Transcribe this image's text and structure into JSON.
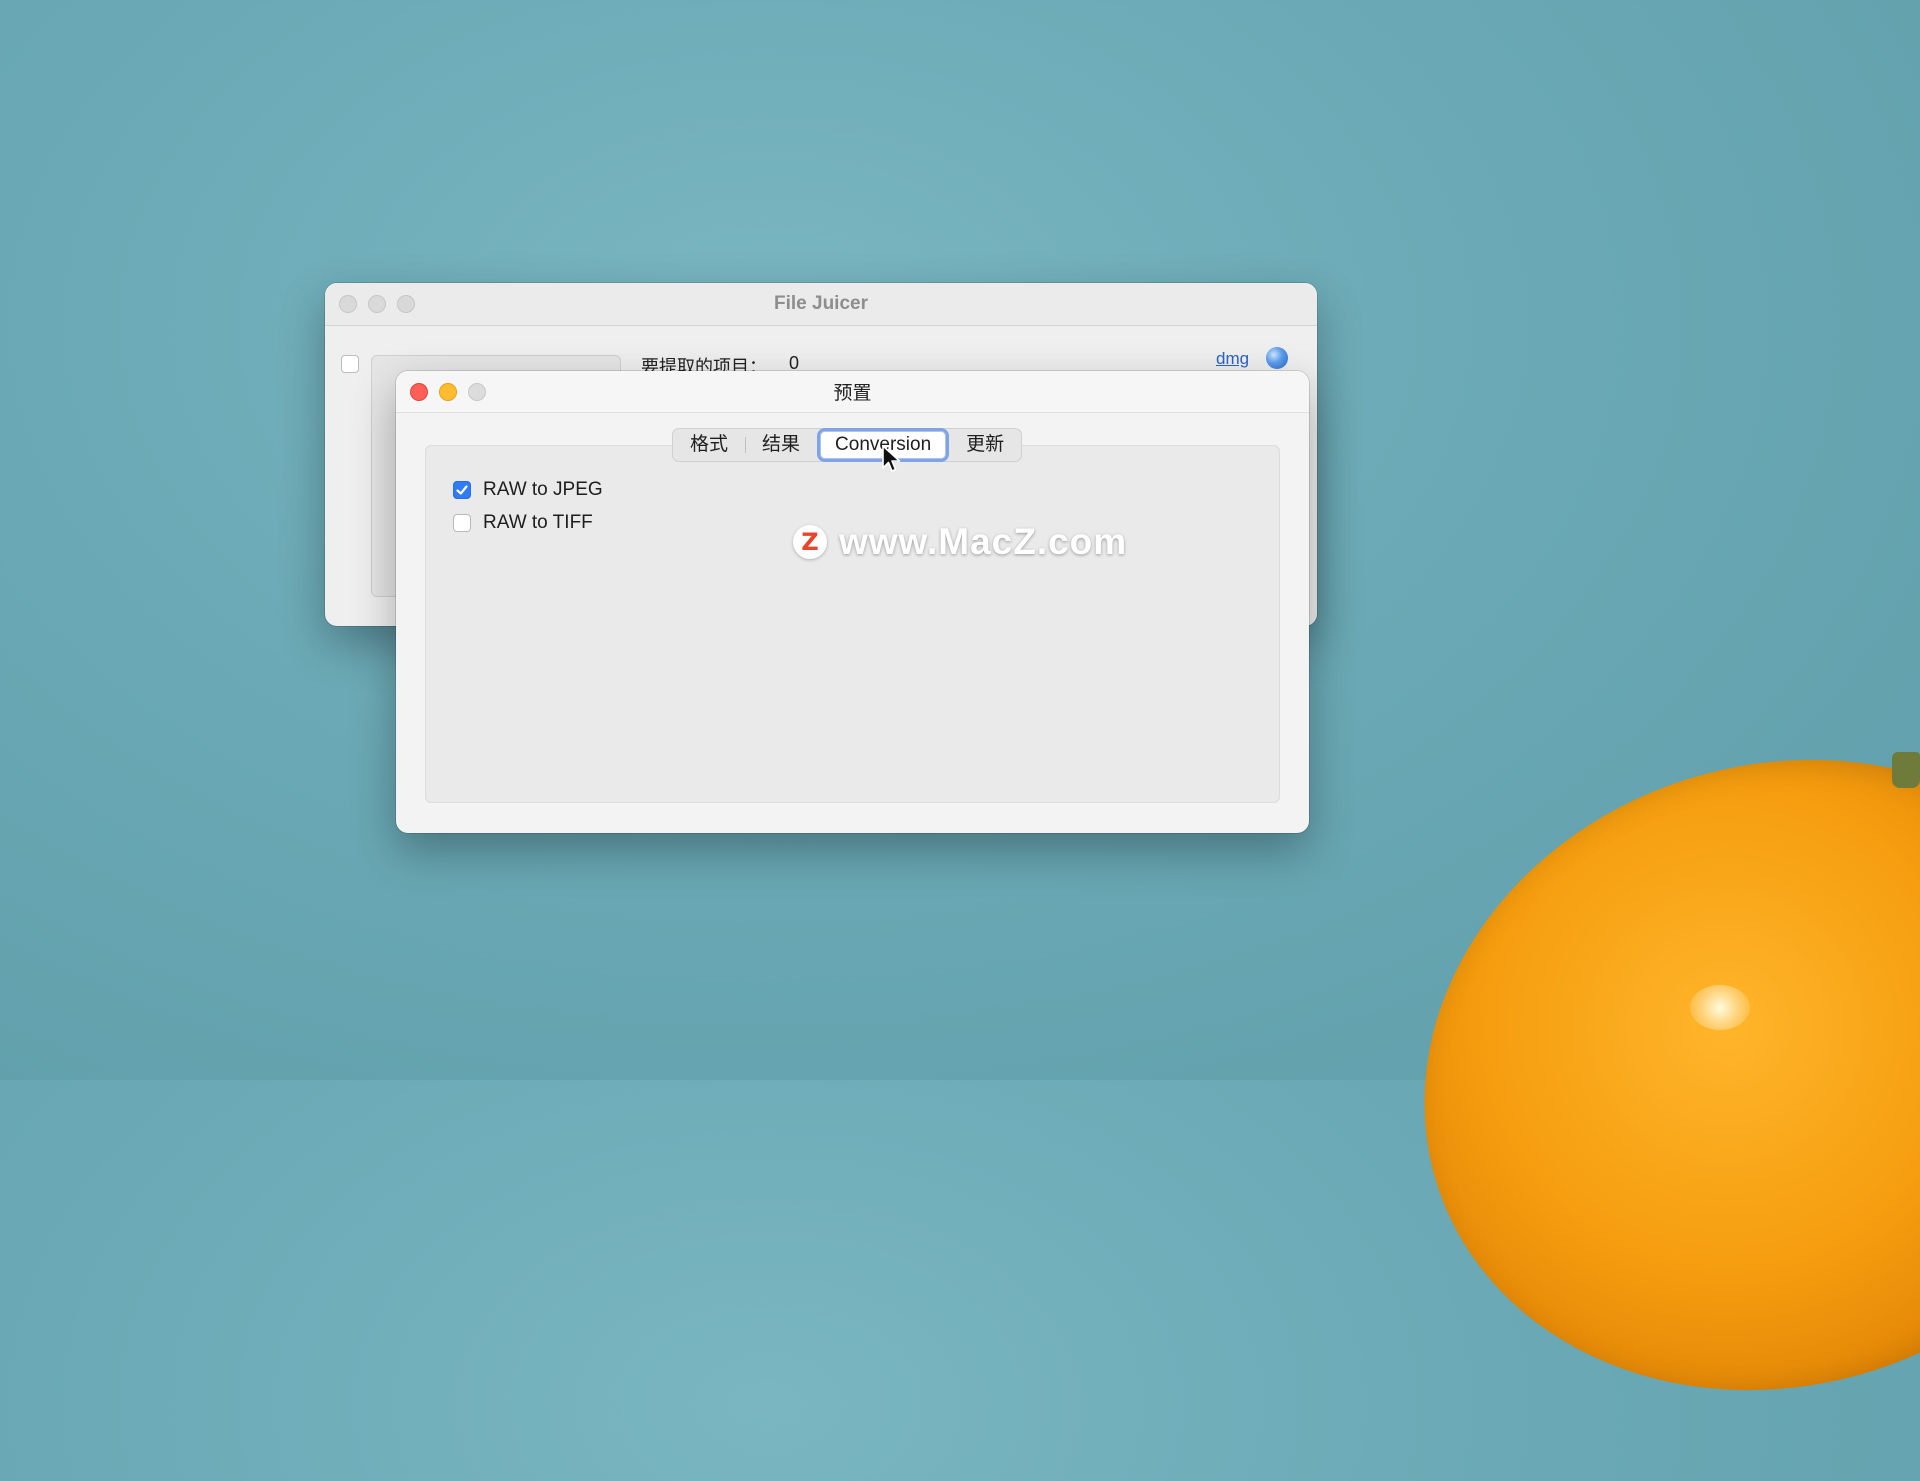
{
  "main_window": {
    "title": "File Juicer",
    "items_label": "要提取的项目：",
    "items_count": "0",
    "format_link": "dmg"
  },
  "prefs_window": {
    "title": "预置",
    "tabs": [
      {
        "label": "格式"
      },
      {
        "label": "结果"
      },
      {
        "label": "Conversion",
        "selected": true
      },
      {
        "label": "更新"
      }
    ],
    "options": [
      {
        "label": "RAW to JPEG",
        "checked": true
      },
      {
        "label": "RAW to TIFF",
        "checked": false
      }
    ]
  },
  "watermark": {
    "badge": "Z",
    "text": "www.MacZ.com"
  },
  "colors": {
    "accent": "#2f7cf6",
    "tab_focus_ring": "#7ea3e6",
    "close": "#ff5f57",
    "minimize": "#febc2e",
    "desktop": "#6aa9b5"
  },
  "icons": [
    "close-icon",
    "minimize-icon",
    "zoom-icon",
    "globe-icon",
    "checkmark-icon",
    "pointer-cursor-icon"
  ]
}
